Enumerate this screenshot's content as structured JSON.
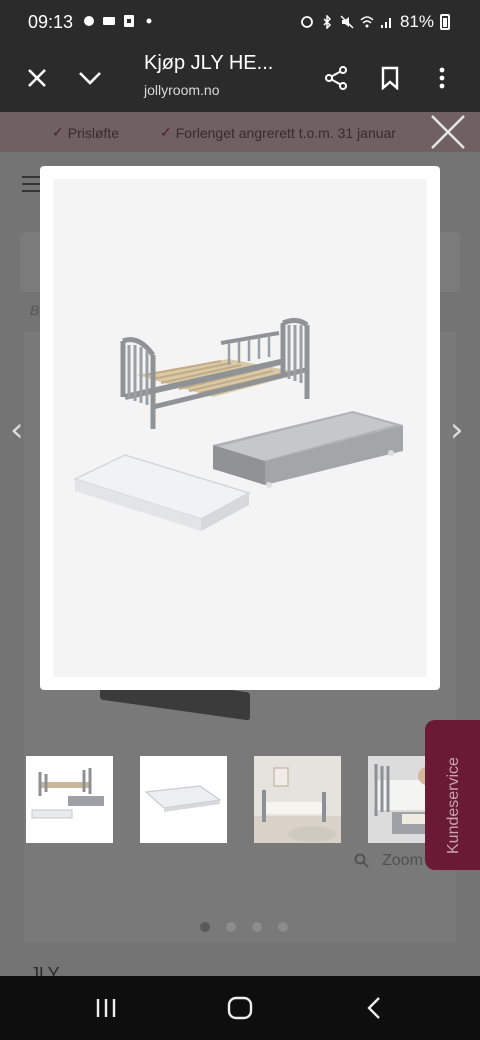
{
  "status_bar": {
    "time": "09:13",
    "battery": "81%"
  },
  "browser": {
    "title": "Kjøp JLY HE...",
    "url": "jollyroom.no"
  },
  "promo": {
    "items": [
      "Prisløfte",
      "Forlenget angrerett t.o.m. 31 januar"
    ]
  },
  "page": {
    "breadcrumb_stub": "B",
    "zoom_label": "Zoom",
    "heading_stub": "JLY",
    "customer_service_label": "Kundeservice",
    "carousel_dots": 4,
    "active_dot": 0
  },
  "colors": {
    "status_bg": "#2b2b2b",
    "promo_bg": "#6f6063",
    "accent": "#6b1a35",
    "overlay": "#747474",
    "nav_bg": "#0e0e0e"
  }
}
